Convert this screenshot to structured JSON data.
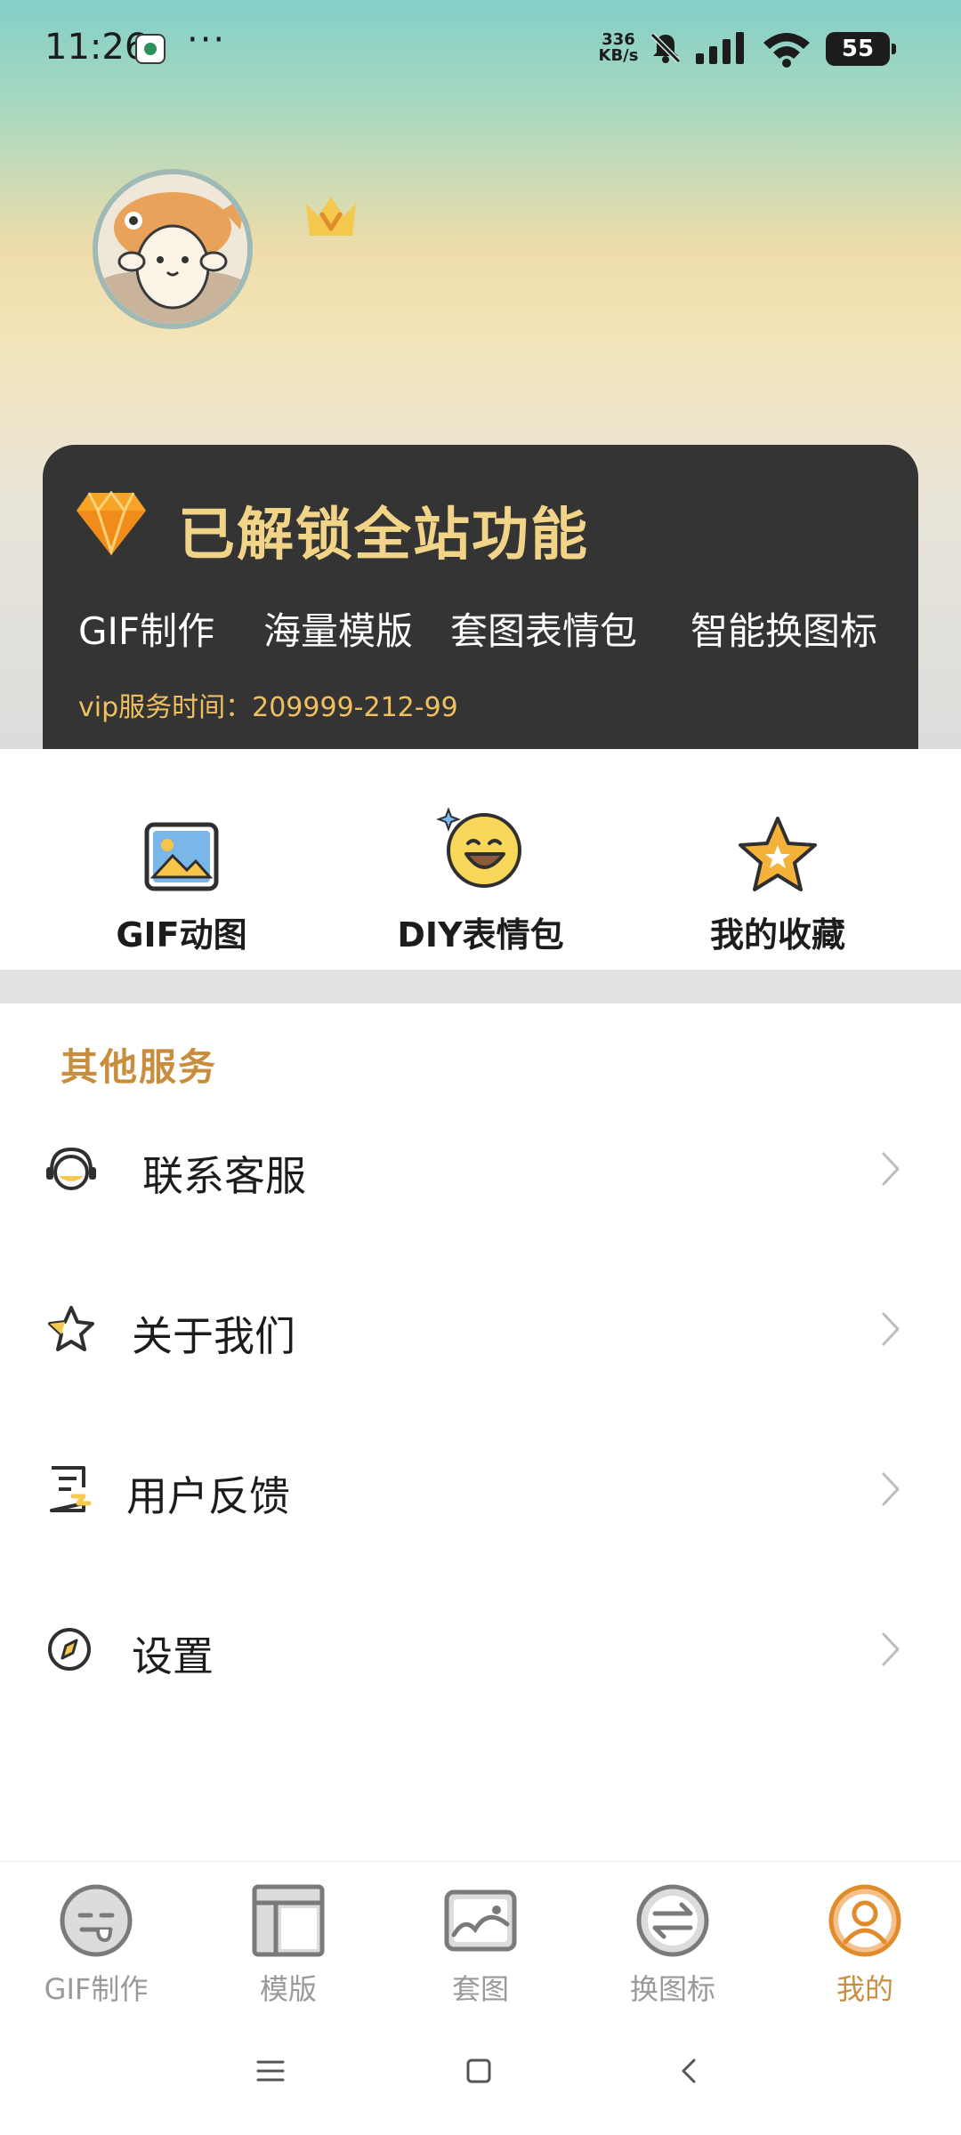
{
  "status_bar": {
    "time": "11:26",
    "more": "···",
    "net_speed_value": "336",
    "net_speed_unit": "KB/s",
    "battery": "55"
  },
  "profile": {
    "avatar_icon": "taiyaki-character-avatar",
    "vip_badge_icon": "crown-icon"
  },
  "vip_card": {
    "title": "已解锁全站功能",
    "features": [
      "GIF制作",
      "海量模版",
      "套图表情包",
      "智能换图标"
    ],
    "service_time": "vip服务时间：209999-212-99",
    "accent_color": "#f2d488"
  },
  "quick_actions": [
    {
      "label": "GIF动图",
      "icon": "image-frame-icon"
    },
    {
      "label": "DIY表情包",
      "icon": "smiley-face-icon"
    },
    {
      "label": "我的收藏",
      "icon": "star-icon"
    }
  ],
  "other_services": {
    "title": "其他服务",
    "items": [
      {
        "label": "联系客服",
        "icon": "headset-icon"
      },
      {
        "label": "关于我们",
        "icon": "star-outline-icon"
      },
      {
        "label": "用户反馈",
        "icon": "feedback-form-icon"
      },
      {
        "label": "设置",
        "icon": "compass-settings-icon"
      }
    ]
  },
  "bottom_nav": {
    "items": [
      {
        "label": "GIF制作",
        "icon": "gif-face-icon",
        "active": false
      },
      {
        "label": "模版",
        "icon": "template-layout-icon",
        "active": false
      },
      {
        "label": "套图",
        "icon": "picture-set-icon",
        "active": false
      },
      {
        "label": "换图标",
        "icon": "swap-icon",
        "active": false
      },
      {
        "label": "我的",
        "icon": "profile-icon",
        "active": true
      }
    ],
    "active_color": "#c98e3d",
    "inactive_color": "#9a9a9a"
  }
}
